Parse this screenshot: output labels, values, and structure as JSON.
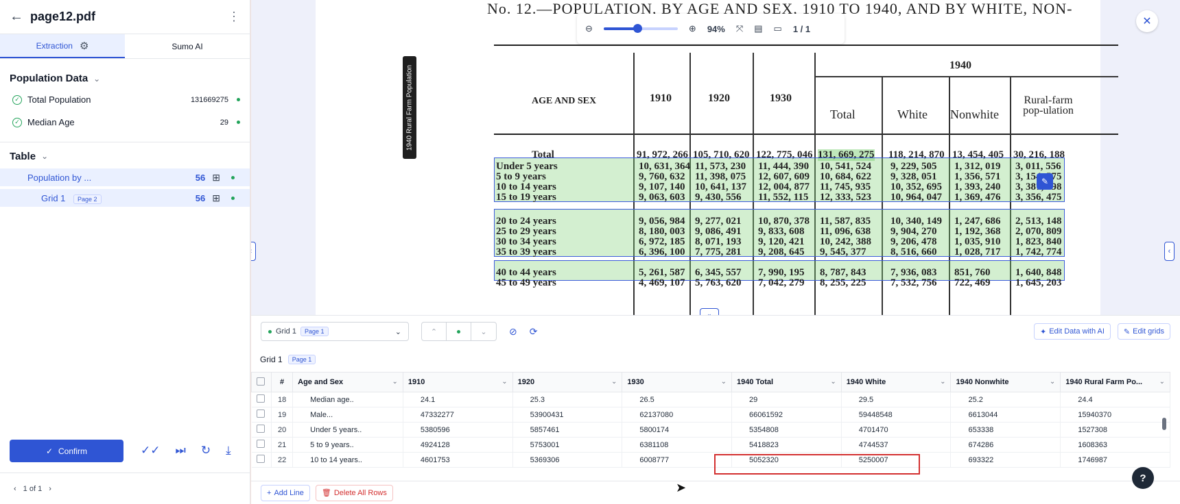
{
  "file": {
    "title": "page12.pdf"
  },
  "tabs": [
    "Extraction",
    "Sumo AI"
  ],
  "population_section": {
    "title": "Population Data",
    "fields": [
      {
        "label": "Total Population",
        "value": "131669275"
      },
      {
        "label": "Median Age",
        "value": "29"
      }
    ]
  },
  "table_section": {
    "title": "Table",
    "items": [
      {
        "label": "Population by ...",
        "count": "56"
      },
      {
        "label": "Grid 1",
        "badge": "Page 2",
        "count": "56"
      }
    ]
  },
  "actions": {
    "confirm": "Confirm"
  },
  "pager": {
    "label": "1 of 1"
  },
  "viewer": {
    "zoom": "94%",
    "page": "1 / 1",
    "zoom_level": 0.45
  },
  "document": {
    "title": "No. 12.—POPULATION, BY AGE AND SEX, 1910 TO 1940, AND BY WHITE, NON-",
    "rotated_label": "1940 Rural Farm Population",
    "headers": [
      "AGE AND SEX",
      "1910",
      "1920",
      "1930",
      "1940",
      "Total",
      "White",
      "Nonwhite",
      "Rural-farm pop-ulation"
    ],
    "total_row": [
      "Total",
      "91, 972, 266",
      "105, 710, 620",
      "122, 775, 046",
      "131, 669, 275",
      "118, 214, 870",
      "13, 454, 405",
      "30, 216, 188"
    ],
    "rows": [
      [
        "Under 5 years",
        "10, 631, 364",
        "11, 573, 230",
        "11, 444, 390",
        "10, 541, 524",
        "9, 229, 505",
        "1, 312, 019",
        "3, 011, 556"
      ],
      [
        "5 to 9 years",
        "9, 760, 632",
        "11, 398, 075",
        "12, 607, 609",
        "10, 684, 622",
        "9, 328, 051",
        "1, 356, 571",
        "3, 154, 575"
      ],
      [
        "10 to 14 years",
        "9, 107, 140",
        "10, 641, 137",
        "12, 004, 877",
        "11, 745, 935",
        "10, 352, 695",
        "1, 393, 240",
        "3, 387, 598"
      ],
      [
        "15 to 19 years",
        "9, 063, 603",
        "9, 430, 556",
        "11, 552, 115",
        "12, 333, 523",
        "10, 964, 047",
        "1, 369, 476",
        "3, 356, 475"
      ],
      [
        "20 to 24 years",
        "9, 056, 984",
        "9, 277, 021",
        "10, 870, 378",
        "11, 587, 835",
        "10, 340, 149",
        "1, 247, 686",
        "2, 513, 148"
      ],
      [
        "25 to 29 years",
        "8, 180, 003",
        "9, 086, 491",
        "9, 833, 608",
        "11, 096, 638",
        "9, 904, 270",
        "1, 192, 368",
        "2, 070, 809"
      ],
      [
        "30 to 34 years",
        "6, 972, 185",
        "8, 071, 193",
        "9, 120, 421",
        "10, 242, 388",
        "9, 206, 478",
        "1, 035, 910",
        "1, 823, 840"
      ],
      [
        "35 to 39 years",
        "6, 396, 100",
        "7, 775, 281",
        "9, 208, 645",
        "9, 545, 377",
        "8, 516, 660",
        "1, 028, 717",
        "1, 742, 774"
      ],
      [
        "40 to 44 years",
        "5, 261, 587",
        "6, 345, 557",
        "7, 990, 195",
        "8, 787, 843",
        "7, 936, 083",
        "851, 760",
        "1, 640, 848"
      ],
      [
        "45 to 49 years",
        "4, 469, 107",
        "5, 763, 620",
        "7, 042, 279",
        "8, 255, 225",
        "7, 532, 756",
        "722, 469",
        "1, 645, 203"
      ]
    ]
  },
  "grid": {
    "selector_label": "Grid 1",
    "selector_badge": "Page 1",
    "label": "Grid 1",
    "badge": "Page 1",
    "edit_ai": "Edit Data with AI",
    "edit_grids": "Edit grids",
    "columns": [
      "#",
      "Age and Sex",
      "1910",
      "1920",
      "1930",
      "1940 Total",
      "1940 White",
      "1940 Nonwhite",
      "1940 Rural Farm Po..."
    ],
    "rows": [
      [
        "18",
        "Median age..",
        "24.1",
        "25.3",
        "26.5",
        "29",
        "29.5",
        "25.2",
        "24.4"
      ],
      [
        "19",
        "Male...",
        "47332277",
        "53900431",
        "62137080",
        "66061592",
        "59448548",
        "6613044",
        "15940370"
      ],
      [
        "20",
        "Under 5 years..",
        "5380596",
        "5857461",
        "5800174",
        "5354808",
        "4701470",
        "653338",
        "1527308"
      ],
      [
        "21",
        "5 to 9 years..",
        "4924128",
        "5753001",
        "6381108",
        "5418823",
        "4744537",
        "674286",
        "1608363"
      ],
      [
        "22",
        "10 to 14 years..",
        "4601753",
        "5369306",
        "6008777",
        "5052320",
        "5250007",
        "693322",
        "1746987"
      ]
    ],
    "add_line": "Add Line",
    "delete_all": "Delete All Rows"
  },
  "colors": {
    "accent": "#2f55d4",
    "success": "#22a35a",
    "highlight": "#82d278",
    "error": "#d32f2f"
  }
}
